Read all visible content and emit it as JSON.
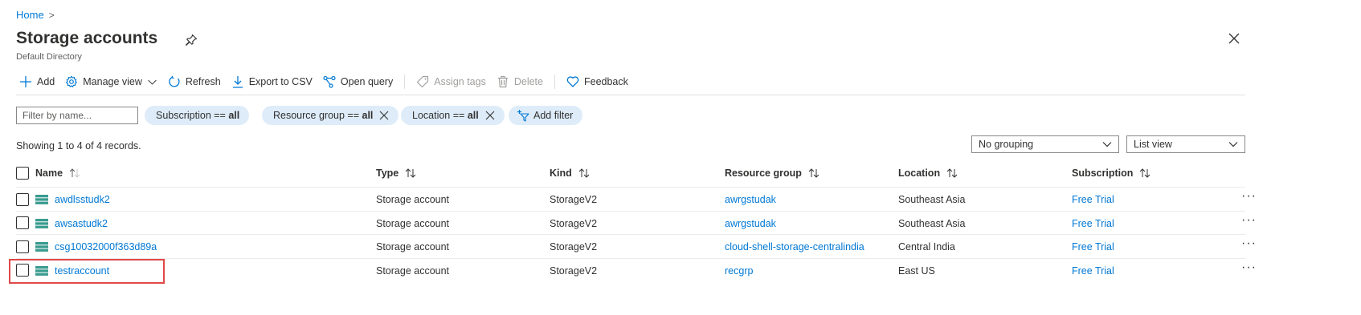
{
  "breadcrumb": {
    "home": "Home",
    "separator": ">"
  },
  "header": {
    "title": "Storage accounts",
    "subtitle": "Default Directory"
  },
  "toolbar": {
    "add": "Add",
    "manage_view": "Manage view",
    "refresh": "Refresh",
    "export_csv": "Export to CSV",
    "open_query": "Open query",
    "assign_tags": "Assign tags",
    "delete": "Delete",
    "feedback": "Feedback"
  },
  "filters": {
    "name_placeholder": "Filter by name...",
    "subscription": {
      "label": "Subscription ==",
      "value": "all"
    },
    "resource_group": {
      "label": "Resource group ==",
      "value": "all"
    },
    "location": {
      "label": "Location ==",
      "value": "all"
    },
    "add_filter": "Add filter"
  },
  "records_text": "Showing 1 to 4 of 4 records.",
  "grouping": {
    "selected": "No grouping"
  },
  "view": {
    "selected": "List view"
  },
  "table": {
    "columns": {
      "name": "Name",
      "type": "Type",
      "kind": "Kind",
      "resource_group": "Resource group",
      "location": "Location",
      "subscription": "Subscription"
    },
    "rows": [
      {
        "name": "awdlsstudk2",
        "type": "Storage account",
        "kind": "StorageV2",
        "resource_group": "awrgstudak",
        "location": "Southeast Asia",
        "subscription": "Free Trial",
        "more": "···"
      },
      {
        "name": "awsastudk2",
        "type": "Storage account",
        "kind": "StorageV2",
        "resource_group": "awrgstudak",
        "location": "Southeast Asia",
        "subscription": "Free Trial",
        "more": "···"
      },
      {
        "name": "csg10032000f363d89a",
        "type": "Storage account",
        "kind": "StorageV2",
        "resource_group": "cloud-shell-storage-centralindia",
        "location": "Central India",
        "subscription": "Free Trial",
        "more": "···"
      },
      {
        "name": "testraccount",
        "type": "Storage account",
        "kind": "StorageV2",
        "resource_group": "recgrp",
        "location": "East US",
        "subscription": "Free Trial",
        "more": "···"
      }
    ]
  },
  "colors": {
    "accent": "#0078d4",
    "pill_bg": "#deecf9",
    "highlight": "#e04848",
    "storage_icon": "#3a9b8f"
  }
}
